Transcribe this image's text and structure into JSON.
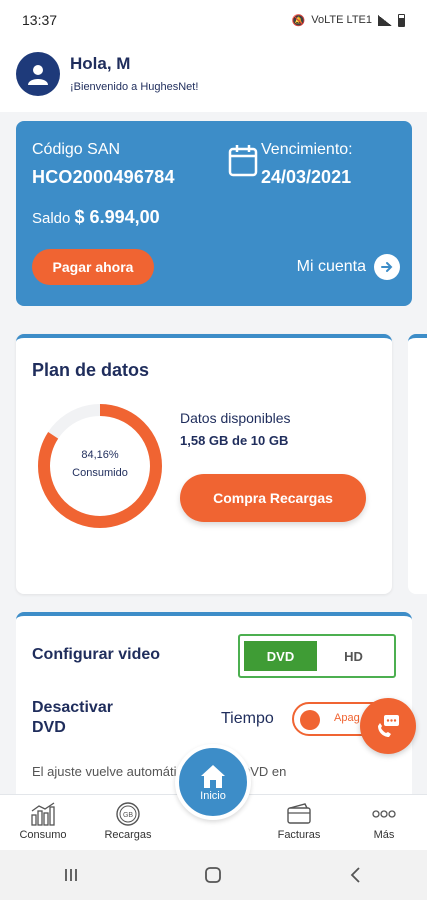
{
  "status_bar": {
    "time": "13:37",
    "network": "VoLTE LTE1"
  },
  "header": {
    "greeting": "Hola, M",
    "welcome": "¡Bienvenido a HughesNet!"
  },
  "account": {
    "san_label": "Código SAN",
    "san_value": "HCO2000496784",
    "due_label": "Vencimiento:",
    "due_value": "24/03/2021",
    "balance_label": "Saldo",
    "balance_value": "$ 6.994,00",
    "pay_button": "Pagar ahora",
    "my_account_link": "Mi cuenta"
  },
  "plan": {
    "title": "Plan de datos",
    "consumed_percent": "84,16%",
    "consumed_label": "Consumido",
    "consumed_fraction": 0.8416,
    "available_label": "Datos disponibles",
    "available_value": "1,58 GB de 10 GB",
    "recharge_button": "Compra Recargas"
  },
  "video": {
    "title": "Configurar video",
    "options": [
      "DVD",
      "HD"
    ],
    "selected": "DVD",
    "disable_label": "Desactivar DVD",
    "time_label": "Tiempo",
    "switch_label": "Apag",
    "note": "El ajuste vuelve automáticamente a DVD en"
  },
  "bottom_nav": {
    "consumo": "Consumo",
    "recargas": "Recargas",
    "inicio": "Inicio",
    "facturas": "Facturas",
    "mas": "Más"
  },
  "colors": {
    "primary_blue": "#3d8dc8",
    "accent_orange": "#f06432",
    "navy": "#1f2d5c",
    "green": "#3f9c35"
  }
}
